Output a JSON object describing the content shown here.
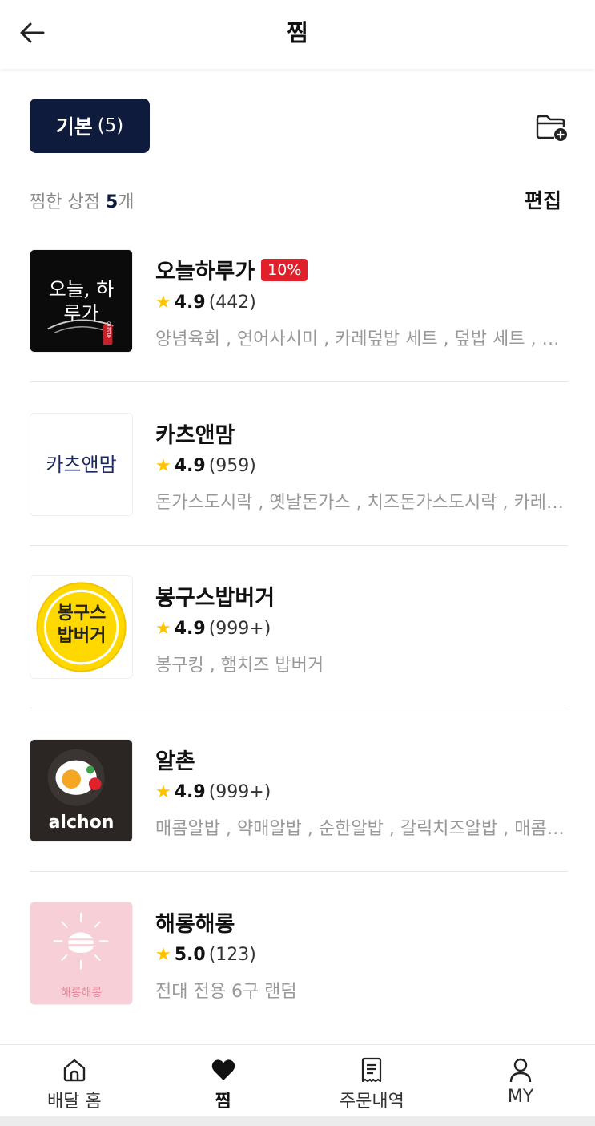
{
  "header": {
    "title": "찜"
  },
  "folder": {
    "name": "기본",
    "count": "(5)"
  },
  "summary": {
    "prefix": "찜한 상점 ",
    "count": "5",
    "suffix": "개",
    "edit_label": "편집"
  },
  "stores": [
    {
      "name": "오늘하루가",
      "badge": "10%",
      "rating": "4.9",
      "reviews": "(442)",
      "menu": "양념육회 , 연어사시미 , 카레덮밥 세트 , 덮밥 세트 , 카레덮밥 , 사이드메뉴",
      "logo_text": "오늘, 하루가",
      "logo_sub": "오하루"
    },
    {
      "name": "카츠앤맘",
      "badge": "",
      "rating": "4.9",
      "reviews": "(959)",
      "menu": "돈가스도시락 , 옛날돈가스 , 치즈돈가스도시락 , 카레돈가스",
      "logo_text": "카츠앤맘"
    },
    {
      "name": "봉구스밥버거",
      "badge": "",
      "rating": "4.9",
      "reviews": "(999+)",
      "menu": "봉구킹 , 햄치즈 밥버거",
      "logo_text": "봉구스 밥버거"
    },
    {
      "name": "알촌",
      "badge": "",
      "rating": "4.9",
      "reviews": "(999+)",
      "menu": "매콤알밥 , 약매알밥 , 순한알밥 , 갈릭치즈알밥 , 매콤치즈알밥",
      "logo_text": "alchon"
    },
    {
      "name": "해롱해롱",
      "badge": "",
      "rating": "5.0",
      "reviews": "(123)",
      "menu": "전대 전용 6구 랜덤",
      "logo_text": "해롱해롱"
    }
  ],
  "nav": [
    {
      "label": "배달 홈",
      "icon": "home-icon"
    },
    {
      "label": "찜",
      "icon": "heart-icon"
    },
    {
      "label": "주문내역",
      "icon": "receipt-icon"
    },
    {
      "label": "MY",
      "icon": "user-icon"
    }
  ],
  "colors": {
    "accent": "#0f1b3c",
    "badge": "#e0202a",
    "star": "#ffc400"
  }
}
